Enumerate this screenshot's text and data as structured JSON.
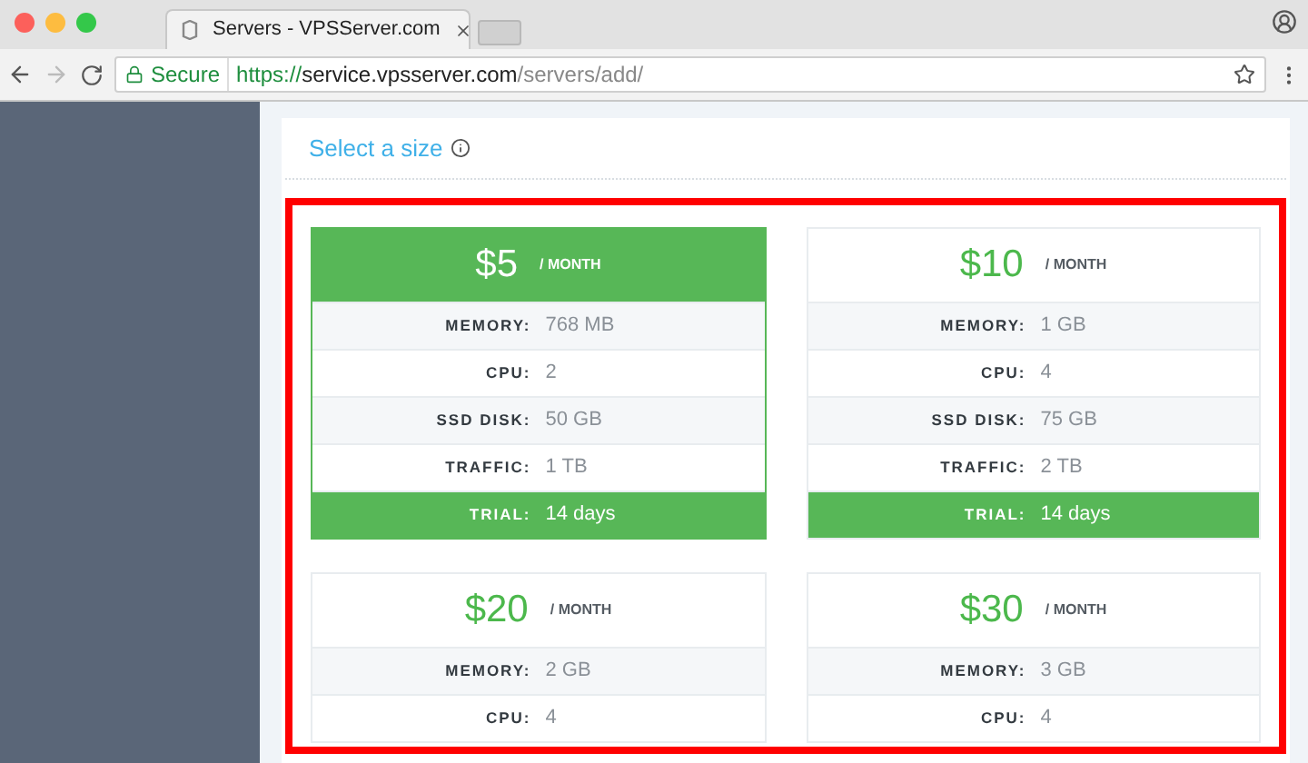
{
  "browser": {
    "tab_title": "Servers - VPSServer.com",
    "secure_label": "Secure",
    "url_scheme": "https://",
    "url_host": "service.vpsserver.com",
    "url_path": "/servers/add/"
  },
  "section": {
    "title": "Select a size"
  },
  "plans": [
    {
      "price": "$5",
      "period": "/ MONTH",
      "selected": true,
      "specs": [
        {
          "kind": "spec",
          "label": "MEMORY:",
          "value": "768 MB"
        },
        {
          "kind": "spec",
          "label": "CPU:",
          "value": "2"
        },
        {
          "kind": "spec",
          "label": "SSD DISK:",
          "value": "50 GB"
        },
        {
          "kind": "spec",
          "label": "TRAFFIC:",
          "value": "1 TB"
        },
        {
          "kind": "trial",
          "label": "TRIAL:",
          "value": "14 days"
        }
      ]
    },
    {
      "price": "$10",
      "period": "/ MONTH",
      "selected": false,
      "specs": [
        {
          "kind": "spec",
          "label": "MEMORY:",
          "value": "1 GB"
        },
        {
          "kind": "spec",
          "label": "CPU:",
          "value": "4"
        },
        {
          "kind": "spec",
          "label": "SSD DISK:",
          "value": "75 GB"
        },
        {
          "kind": "spec",
          "label": "TRAFFIC:",
          "value": "2 TB"
        },
        {
          "kind": "trial",
          "label": "TRIAL:",
          "value": "14 days"
        }
      ]
    },
    {
      "price": "$20",
      "period": "/ MONTH",
      "selected": false,
      "specs": [
        {
          "kind": "spec",
          "label": "MEMORY:",
          "value": "2 GB"
        },
        {
          "kind": "spec",
          "label": "CPU:",
          "value": "4"
        }
      ]
    },
    {
      "price": "$30",
      "period": "/ MONTH",
      "selected": false,
      "specs": [
        {
          "kind": "spec",
          "label": "MEMORY:",
          "value": "3 GB"
        },
        {
          "kind": "spec",
          "label": "CPU:",
          "value": "4"
        }
      ]
    }
  ]
}
